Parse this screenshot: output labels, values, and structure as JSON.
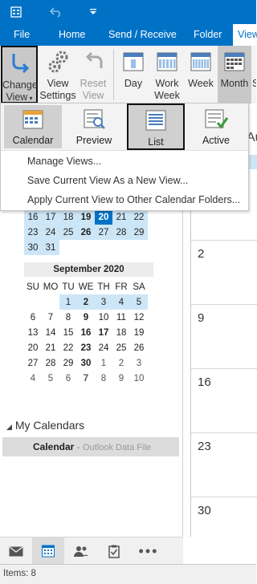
{
  "title_bar": {
    "accent": "#0072c6"
  },
  "tabs": [
    {
      "label": "File"
    },
    {
      "label": "Home"
    },
    {
      "label": "Send / Receive"
    },
    {
      "label": "Folder"
    },
    {
      "label": "View"
    }
  ],
  "ribbon": {
    "change_view": {
      "line1": "Change",
      "line2": "View"
    },
    "view_settings": {
      "line1": "View",
      "line2": "Settings"
    },
    "reset_view": {
      "line1": "Reset",
      "line2": "View"
    },
    "day": "Day",
    "work_week": {
      "line1": "Work",
      "line2": "Week"
    },
    "week": "Week",
    "month": "Month",
    "schedule_cut": "S"
  },
  "change_view_menu": {
    "views": [
      {
        "label": "Calendar"
      },
      {
        "label": "Preview"
      },
      {
        "label": "List"
      },
      {
        "label": "Active"
      }
    ],
    "items": [
      {
        "label": "Manage Views..."
      },
      {
        "label": "Save Current View As a New View..."
      },
      {
        "label": "Apply Current View to Other Calendar Folders..."
      }
    ]
  },
  "august_partial": {
    "weeks": [
      [
        "16",
        "17",
        "18",
        "19",
        "20",
        "21",
        "22"
      ],
      [
        "23",
        "24",
        "25",
        "26",
        "27",
        "28",
        "29"
      ],
      [
        "30",
        "31",
        "",
        "",
        "",
        "",
        ""
      ]
    ],
    "today": "20"
  },
  "september": {
    "title": "September 2020",
    "day_headers": [
      "SU",
      "MO",
      "TU",
      "WE",
      "TH",
      "FR",
      "SA"
    ],
    "weeks": [
      [
        "",
        "",
        "1",
        "2",
        "3",
        "4",
        "5"
      ],
      [
        "6",
        "7",
        "8",
        "9",
        "10",
        "11",
        "12"
      ],
      [
        "13",
        "14",
        "15",
        "16",
        "17",
        "18",
        "19"
      ],
      [
        "20",
        "21",
        "22",
        "23",
        "24",
        "25",
        "26"
      ],
      [
        "27",
        "28",
        "29",
        "30",
        "1",
        "2",
        "3"
      ],
      [
        "4",
        "5",
        "6",
        "7",
        "8",
        "9",
        "10"
      ]
    ]
  },
  "my_calendars": {
    "heading": "My Calendars",
    "item_name": "Calendar",
    "item_sep": " - ",
    "item_source": "Outlook Data File"
  },
  "grid": {
    "header_partial": "Au",
    "dates": [
      "2",
      "9",
      "16",
      "23",
      "30"
    ]
  },
  "status": {
    "items": "Items: 8"
  }
}
